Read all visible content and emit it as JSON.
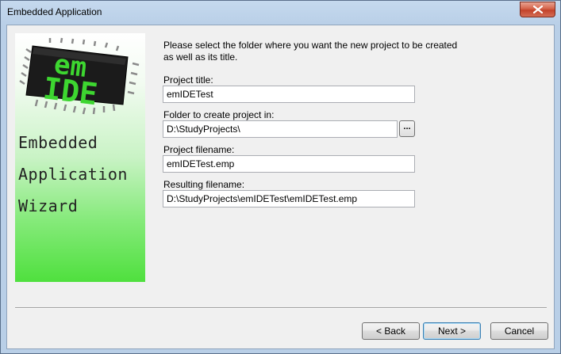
{
  "window": {
    "title": "Embedded Application"
  },
  "banner": {
    "logo_line1": "em",
    "logo_line2": "IDE",
    "wizard_line1": "Embedded",
    "wizard_line2": "Application",
    "wizard_line3": "Wizard"
  },
  "form": {
    "instructions": "Please select the folder where you want the new project to be created as well as its title.",
    "project_title_label": "Project title:",
    "project_title_value": "emIDETest",
    "folder_label": "Folder to create project in:",
    "folder_value": "D:\\StudyProjects\\",
    "browse_label": "...",
    "project_filename_label": "Project filename:",
    "project_filename_value": "emIDETest.emp",
    "resulting_filename_label": "Resulting filename:",
    "resulting_filename_value": "D:\\StudyProjects\\emIDETest\\emIDETest.emp"
  },
  "buttons": {
    "back": "< Back",
    "next": "Next >",
    "cancel": "Cancel"
  },
  "colors": {
    "chip_text": "#3dd630",
    "banner_green": "#4fe03e"
  },
  "icons": {
    "close": "close-icon",
    "logo": "emide-chip-logo"
  }
}
